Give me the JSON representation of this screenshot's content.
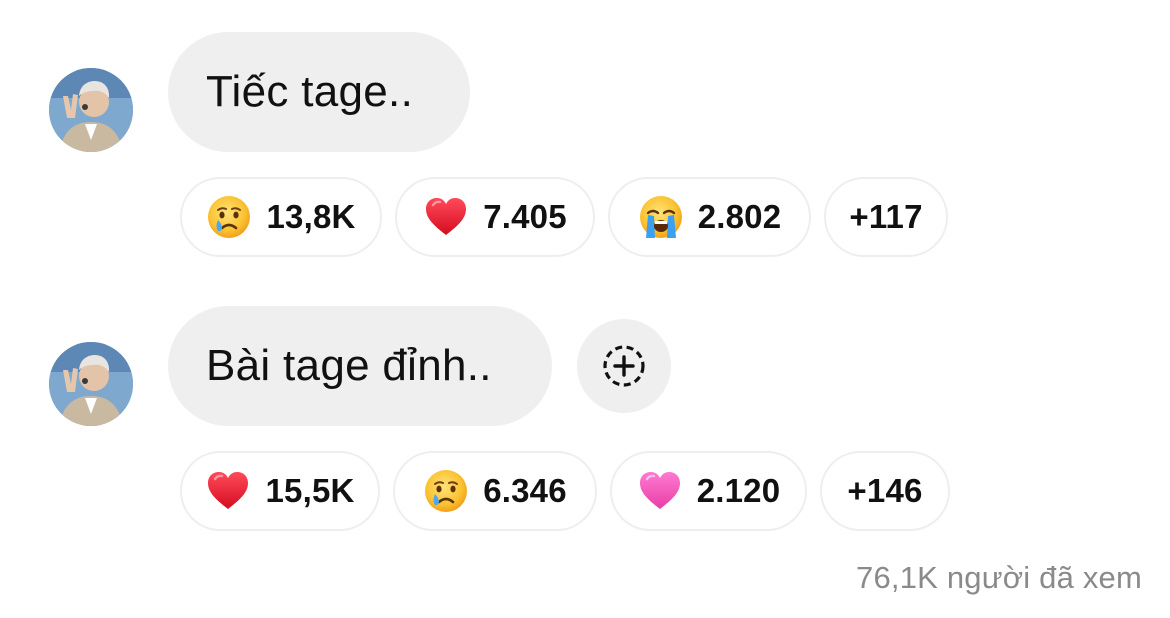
{
  "messages": [
    {
      "text": "Tiếc tage..",
      "reactions": [
        {
          "emoji": "crying-face-icon",
          "count": "13,8K"
        },
        {
          "emoji": "red-heart-icon",
          "count": "7.405"
        },
        {
          "emoji": "loudly-crying-face-icon",
          "count": "2.802"
        },
        {
          "emoji": "",
          "count": "+117"
        }
      ]
    },
    {
      "text": "Bài tage đỉnh..",
      "add_reaction_icon": "add-reaction-icon",
      "reactions": [
        {
          "emoji": "red-heart-icon",
          "count": "15,5K"
        },
        {
          "emoji": "crying-face-icon",
          "count": "6.346"
        },
        {
          "emoji": "pink-heart-icon",
          "count": "2.120"
        },
        {
          "emoji": "",
          "count": "+146"
        }
      ]
    }
  ],
  "footer": {
    "viewers": "76,1K người đã xem"
  },
  "colors": {
    "bubble": "#efefef",
    "pill_border": "#eeeeee",
    "muted_text": "#8a8a8a",
    "heart_red": "#e8112d",
    "heart_pink": "#f050b4"
  }
}
